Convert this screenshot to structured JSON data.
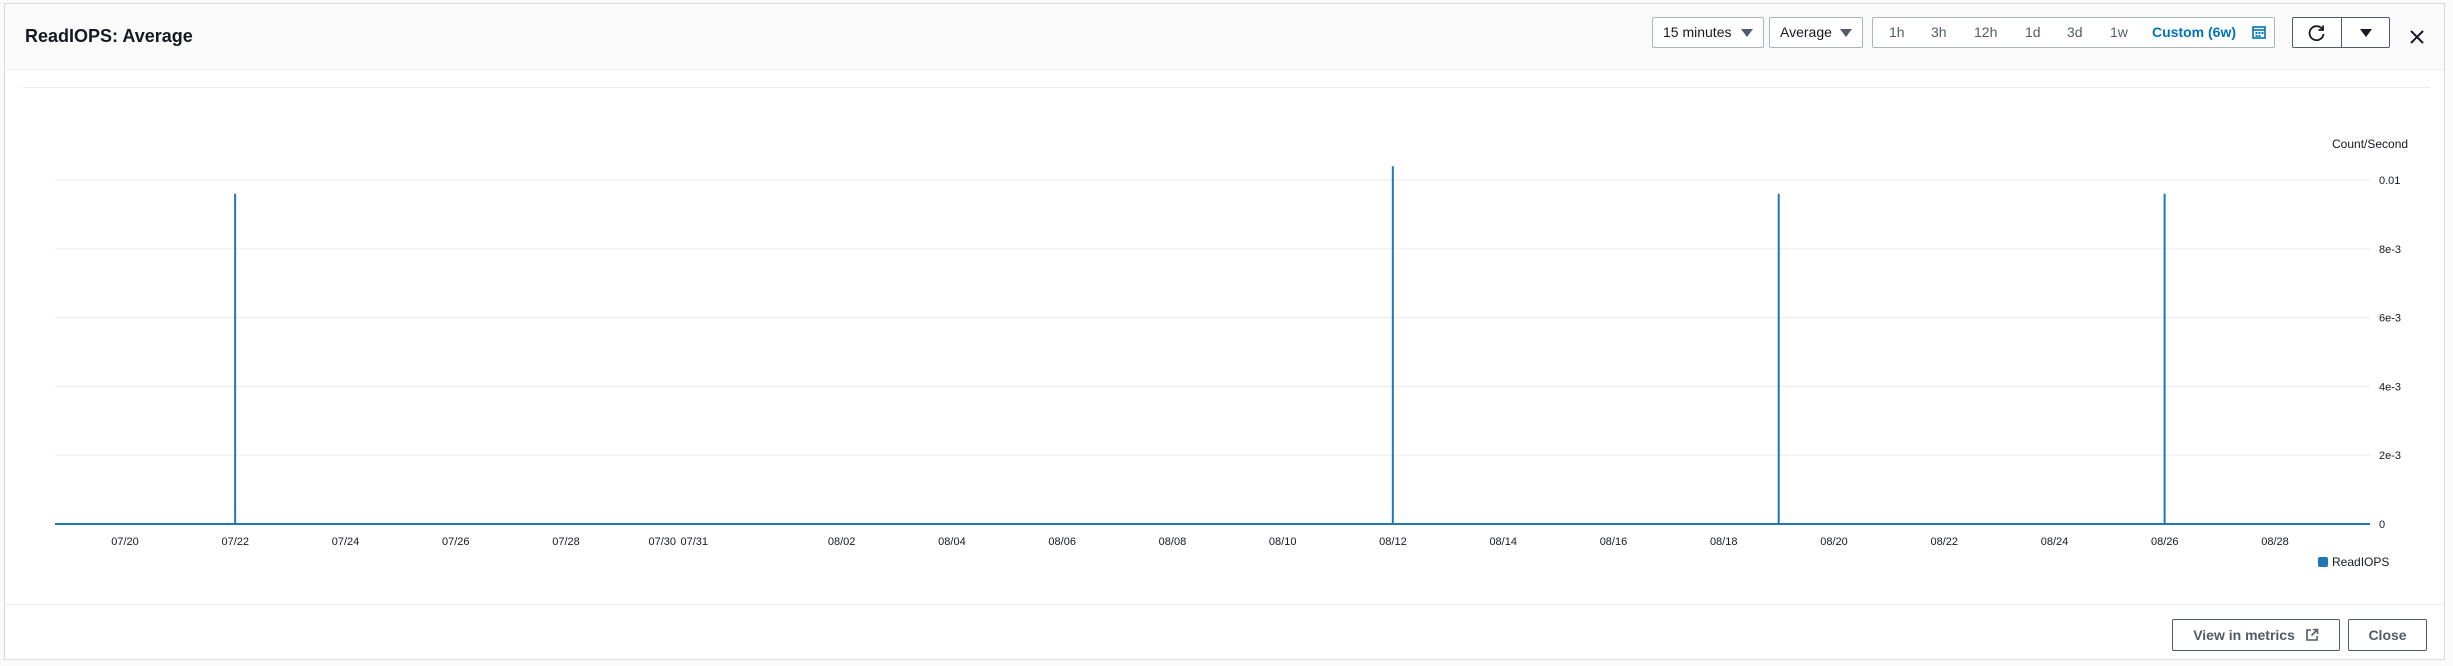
{
  "modal": {
    "title": "ReadIOPS: Average",
    "period": "15 minutes",
    "statistic": "Average",
    "time_ranges": [
      "1h",
      "3h",
      "12h",
      "1d",
      "3d",
      "1w"
    ],
    "custom_range": "Custom (6w)",
    "refresh_icon": "refresh-icon",
    "close_icon": "close-icon",
    "calendar_icon": "calendar-icon"
  },
  "footer": {
    "view_in_metrics": "View in metrics",
    "close": "Close",
    "external_icon": "external-link-icon"
  },
  "colors": {
    "accent": "#0073bb",
    "series": "#1f77b4"
  },
  "chart_data": {
    "type": "line",
    "ylabel": "Count/Second",
    "y_ticks": [
      "0",
      "2e-3",
      "4e-3",
      "6e-3",
      "8e-3",
      "0.01"
    ],
    "ylim": [
      0,
      0.01
    ],
    "x_ticks": [
      "07/20",
      "07/22",
      "07/24",
      "07/26",
      "07/28",
      "07/30",
      "07/31",
      "08/02",
      "08/04",
      "08/06",
      "08/08",
      "08/10",
      "08/12",
      "08/14",
      "08/16",
      "08/18",
      "08/20",
      "08/22",
      "08/24",
      "08/26",
      "08/28"
    ],
    "grid": true,
    "legend_position": "bottom-right",
    "series": [
      {
        "name": "ReadIOPS",
        "color": "#1f77b4",
        "spikes": [
          {
            "x": "07/21",
            "y": 0.0096
          },
          {
            "x": "08/11",
            "y": 0.0104
          },
          {
            "x": "08/18",
            "y": 0.0096
          },
          {
            "x": "08/25",
            "y": 0.0096
          }
        ],
        "baseline": 0
      }
    ]
  }
}
